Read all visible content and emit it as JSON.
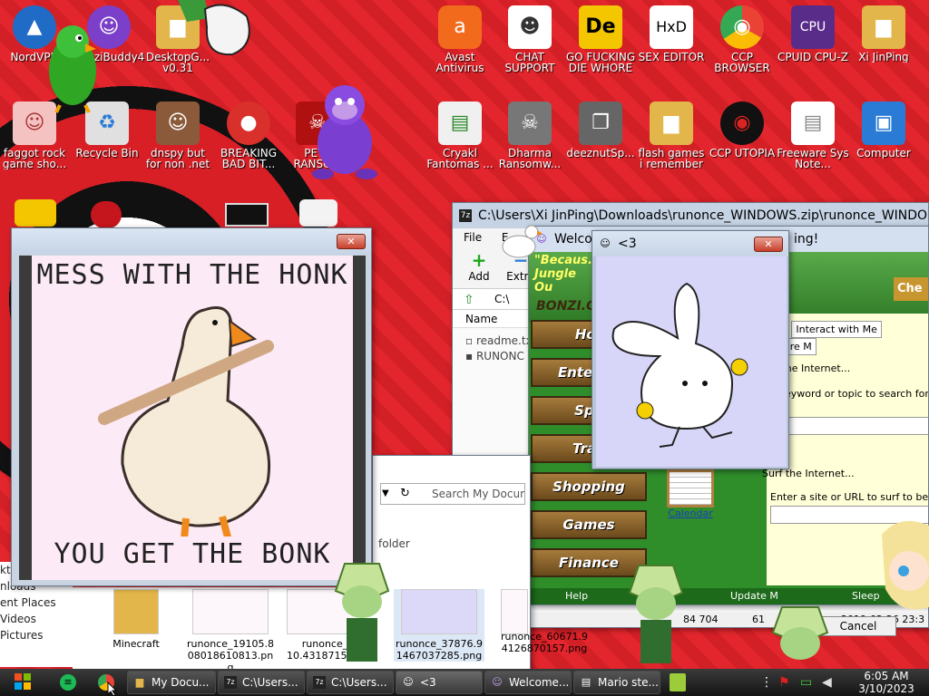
{
  "desktop": {
    "icons": [
      {
        "label": "NordVPN",
        "glyph": "▲",
        "color": "#1f6bc6"
      },
      {
        "label": "BonziBuddy4",
        "glyph": "☺",
        "color": "#7b3fc9"
      },
      {
        "label": "DesktopG... v0.31",
        "glyph": "▆",
        "color": "#e2b64a"
      },
      {
        "label": "Avast Antivirus",
        "glyph": "a",
        "color": "#f26a1c"
      },
      {
        "label": "CHAT SUPPORT",
        "glyph": "☻",
        "color": "#ffffff"
      },
      {
        "label": "GO FUCKING DIE WHORE",
        "glyph": "De",
        "color": "#f3c600"
      },
      {
        "label": "SEX EDITOR",
        "glyph": "HxD",
        "color": "#ffffff"
      },
      {
        "label": "CCP BROWSER",
        "glyph": "◉",
        "color": "#ea4335"
      },
      {
        "label": "CPUID CPU-Z",
        "glyph": "CPU",
        "color": "#5a2c8a"
      },
      {
        "label": "Xi JinPing",
        "glyph": "▆",
        "color": "#e2b64a"
      },
      {
        "label": "faggot rock game sho...",
        "glyph": "☺",
        "color": "#f5c2c2"
      },
      {
        "label": "Recycle Bin",
        "glyph": "♻",
        "color": "#e0e0e0"
      },
      {
        "label": "dnspy but for non .net pr...",
        "glyph": "☺",
        "color": "#8a5a3a"
      },
      {
        "label": "BREAKING BAD BIT...",
        "glyph": "●",
        "color": "#d9302c"
      },
      {
        "label": "PETY RANSO...",
        "glyph": "☠",
        "color": "#b01010"
      },
      {
        "label": "Cryakl Fantomas ...",
        "glyph": "▤",
        "color": "#f0f0f0"
      },
      {
        "label": "Dharma Ransomw...",
        "glyph": "☠",
        "color": "#777777"
      },
      {
        "label": "deeznutSp...",
        "glyph": "❐",
        "color": "#666666"
      },
      {
        "label": "flash games i remember",
        "glyph": "▆",
        "color": "#e2b64a"
      },
      {
        "label": "CCP UTOPIA",
        "glyph": "◉",
        "color": "#111111"
      },
      {
        "label": "Freeware Sys Note...",
        "glyph": "▤",
        "color": "#ffffff"
      },
      {
        "label": "Computer",
        "glyph": "▣",
        "color": "#2a7bd6"
      }
    ]
  },
  "honk_window": {
    "line1": "MESS WITH THE HONK",
    "line2": "YOU GET THE BONK"
  },
  "sevenzip": {
    "title": "C:\\Users\\Xi JinPing\\Downloads\\runonce_WINDOWS.zip\\runonce_WINDO",
    "menu": [
      "File",
      "E"
    ],
    "toolbar": {
      "add": "Add",
      "extract": "Extra"
    },
    "path": "C:\\",
    "column_name": "Name",
    "files": [
      "readme.tx",
      "RUNONC"
    ],
    "status_bits": [
      "84 704",
      "61",
      "2019-02-26 23:3"
    ]
  },
  "bonzi": {
    "title": "Welco",
    "title_tail": "ing!",
    "slogan": "\"Becaus... Jungle Ou",
    "brand": "BONZI.C",
    "nav": [
      "Hor",
      "Entertai",
      "Spo",
      "Trav",
      "Shopping",
      "Games",
      "Finance"
    ],
    "bottom_links": [
      "Help",
      "Update M",
      "Sleep"
    ],
    "tabs": [
      "urf",
      "Interact with Me",
      "Share M"
    ],
    "internet_label": "n the Internet...",
    "search_hint": "r keyword or topic to search for b",
    "surf_title": "Surf the Internet...",
    "surf_prompt": "Enter a site or URL to surf to below:",
    "calendar": "Calendar",
    "ok": "Ok",
    "cancel": "Cancel",
    "corner_btn": "Che"
  },
  "rabbit_window": {
    "title": "<3"
  },
  "mydocs": {
    "search_placeholder": "Search My Docume",
    "folder_label": "folder",
    "sidebar": [
      "ktop",
      "nloads",
      "ent Places",
      "Videos",
      "Pictures"
    ],
    "items": [
      {
        "label": "Minecraft"
      },
      {
        "label": "runonce_19105.808018610813.png"
      },
      {
        "label": "runonce_ 10.4318715...7"
      },
      {
        "label": "runonce_37876.91467037285.png"
      },
      {
        "label": "runonce_60671.94126870157.png"
      }
    ]
  },
  "taskbar": {
    "tasks": [
      {
        "label": "My Docu...",
        "icon": "▆"
      },
      {
        "label": "C:\\Users...",
        "icon": "7z"
      },
      {
        "label": "C:\\Users...",
        "icon": "7z"
      },
      {
        "label": "<3",
        "icon": "☺"
      },
      {
        "label": "Welcome...",
        "icon": "☺"
      },
      {
        "label": "Mario ste...",
        "icon": "▤"
      }
    ],
    "time": "6:05 AM",
    "date": "3/10/2023"
  },
  "colors": {
    "desktop_red": "#d3232a",
    "taskbar": "#1e1e1e",
    "bonzi_green": "#2f8d2a"
  }
}
